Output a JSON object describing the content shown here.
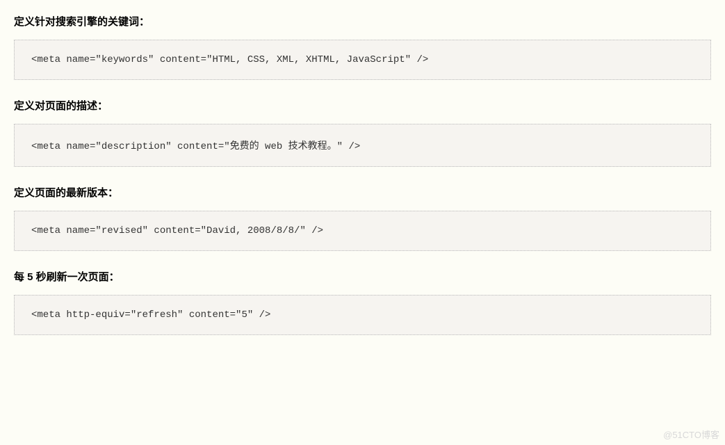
{
  "sections": [
    {
      "heading": "定义针对搜索引擎的关键词：",
      "code": "<meta name=\"keywords\" content=\"HTML, CSS, XML, XHTML, JavaScript\" />"
    },
    {
      "heading": "定义对页面的描述：",
      "code": "<meta name=\"description\" content=\"免费的 web 技术教程。\" />"
    },
    {
      "heading": "定义页面的最新版本：",
      "code": "<meta name=\"revised\" content=\"David, 2008/8/8/\" />"
    },
    {
      "heading": "每 5 秒刷新一次页面：",
      "code": "<meta http-equiv=\"refresh\" content=\"5\" />"
    }
  ],
  "watermark": "@51CTO博客"
}
